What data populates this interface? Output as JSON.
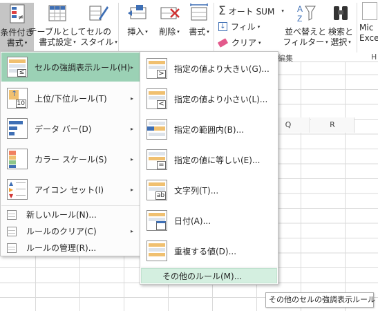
{
  "ribbon": {
    "conditional": {
      "line1": "条件付き",
      "line2": "書式",
      "caret": "▾"
    },
    "table": {
      "line1": "テーブルとして",
      "line2": "書式設定",
      "caret": "▾"
    },
    "cellstyle": {
      "line1": "セルの",
      "line2": "スタイル",
      "caret": "▾"
    },
    "insert": {
      "label": "挿入",
      "caret": "▾"
    },
    "delete": {
      "label": "削除",
      "caret": "▾"
    },
    "format": {
      "label": "書式",
      "caret": "▾"
    },
    "autosum": {
      "label": "オート SUM",
      "caret": "▾"
    },
    "fill": {
      "label": "フィル",
      "caret": "▾"
    },
    "clear": {
      "label": "クリア",
      "caret": "▾"
    },
    "sort": {
      "line1": "並べ替えと",
      "line2": "フィルター",
      "caret": "▾"
    },
    "find": {
      "line1": "検索と",
      "line2": "選択",
      "caret": "▾"
    },
    "mic": {
      "line1": "Mic",
      "line2": "Exce"
    },
    "group_edit": "編集",
    "group_h": "H"
  },
  "grid": {
    "columns": [
      "Q",
      "R"
    ]
  },
  "menu": {
    "items": [
      {
        "label": "セルの強調表示ルール(H)",
        "arrow": "▸"
      },
      {
        "label": "上位/下位ルール(T)",
        "arrow": "▸",
        "icon_text": "10"
      },
      {
        "label": "データ バー(D)",
        "arrow": "▸"
      },
      {
        "label": "カラー スケール(S)",
        "arrow": "▸"
      },
      {
        "label": "アイコン セット(I)",
        "arrow": "▸"
      }
    ],
    "small_items": [
      {
        "label": "新しいルール(N)..."
      },
      {
        "label": "ルールのクリア(C)",
        "arrow": "▸"
      },
      {
        "label": "ルールの管理(R)..."
      }
    ]
  },
  "submenu": {
    "items": [
      {
        "label": "指定の値より大きい(G)...",
        "icon_text": ">"
      },
      {
        "label": "指定の値より小さい(L)...",
        "icon_text": "<"
      },
      {
        "label": "指定の範囲内(B)..."
      },
      {
        "label": "指定の値に等しい(E)...",
        "icon_text": "="
      },
      {
        "label": "文字列(T)...",
        "icon_text": "ab"
      },
      {
        "label": "日付(A)..."
      },
      {
        "label": "重複する値(D)..."
      }
    ],
    "other": "その他のルール(M)..."
  },
  "tooltip": "その他のセルの強調表示ルール",
  "colors": {
    "highlight": "#9bd1b5",
    "hover": "#d4efe0",
    "accent_orange": "#f0c070",
    "accent_blue": "#3e6fb5"
  }
}
